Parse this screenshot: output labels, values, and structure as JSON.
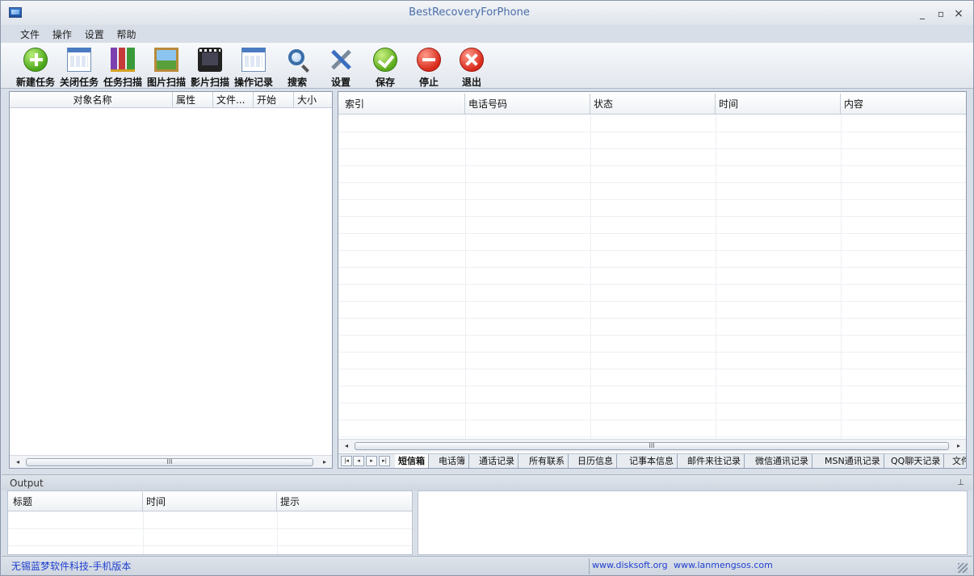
{
  "window": {
    "title": "BestRecoveryForPhone",
    "minimize": "_",
    "maximize": "▫",
    "close": "×"
  },
  "menu": [
    "文件",
    "操作",
    "设置",
    "帮助"
  ],
  "toolbar": [
    {
      "label": "新建任务",
      "icon": "new-task-icon"
    },
    {
      "label": "关闭任务",
      "icon": "close-task-icon"
    },
    {
      "label": "任务扫描",
      "icon": "task-scan-icon"
    },
    {
      "label": "图片扫描",
      "icon": "image-scan-icon"
    },
    {
      "label": "影片扫描",
      "icon": "video-scan-icon"
    },
    {
      "label": "操作记录",
      "icon": "operation-log-icon"
    },
    {
      "label": "搜索",
      "icon": "search-icon"
    },
    {
      "label": "设置",
      "icon": "settings-icon"
    },
    {
      "label": "保存",
      "icon": "save-icon"
    },
    {
      "label": "停止",
      "icon": "stop-icon"
    },
    {
      "label": "退出",
      "icon": "exit-icon"
    }
  ],
  "left_panel": {
    "columns": [
      "对象名称",
      "属性",
      "文件...",
      "开始",
      "大小"
    ]
  },
  "right_panel": {
    "columns": [
      "索引",
      "电话号码",
      "状态",
      "时间",
      "内容"
    ],
    "tabs": [
      "短信箱",
      "电话簿",
      "通话记录",
      "所有联系",
      "日历信息",
      "记事本信息",
      "邮件来往记录",
      "微信通讯记录",
      "MSN通讯记录",
      "QQ聊天记录",
      "文件"
    ],
    "active_tab": "短信箱"
  },
  "output": {
    "title": "Output",
    "columns": [
      "标题",
      "时间",
      "提示"
    ]
  },
  "scroll": {
    "left": "◂",
    "right": "▸",
    "thumb": "III"
  },
  "tab_nav": [
    "|◂",
    "◂",
    "▸",
    "▸|"
  ],
  "status": {
    "left": "无锡蓝梦软件科技-手机版本",
    "link1": "www.disksoft.org",
    "link2": "www.lanmengsos.com"
  }
}
